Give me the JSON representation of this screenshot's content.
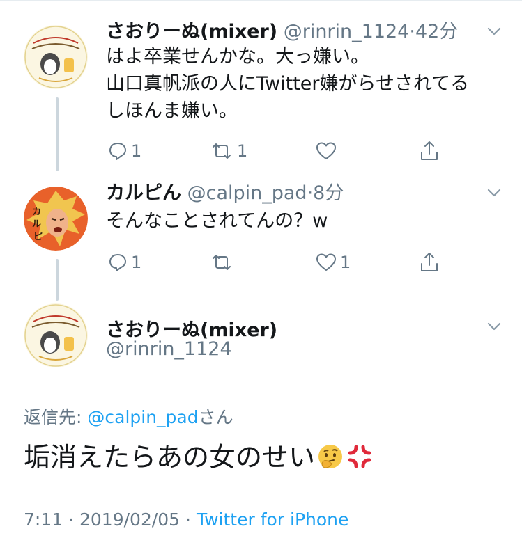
{
  "tweets": [
    {
      "name": "さおりーぬ(mixer)",
      "handle": "@rinrin_1124",
      "time": "42分",
      "lines": [
        "はよ卒業せんかな。大っ嫌い。",
        "山口真帆派の人にTwitter嫌がらせされてる",
        "しほんま嫌い。"
      ],
      "reply_count": "1",
      "retweet_count": "1",
      "like_count": ""
    },
    {
      "name": "カルピん",
      "handle": "@calpin_pad",
      "time": "8分",
      "lines": [
        "そんなことされてんの？w"
      ],
      "reply_count": "1",
      "retweet_count": "",
      "like_count": "1"
    }
  ],
  "main_tweet": {
    "name": "さおりーぬ(mixer)",
    "handle": "@rinrin_1124",
    "reply_prefix": "返信先: ",
    "reply_handle": "@calpin_pad",
    "reply_suffix": "さん",
    "text": "垢消えたらあの女のせい",
    "time": "7:11",
    "date": "2019/02/05",
    "source": "Twitter for iPhone"
  },
  "colors": {
    "link": "#1da1f2",
    "secondary": "#657786",
    "thread_line": "#ccd6dd"
  },
  "icons": [
    "chevron-down-icon",
    "reply-icon",
    "retweet-icon",
    "like-icon",
    "share-icon",
    "thinking-face-emoji",
    "anger-symbol-emoji"
  ]
}
